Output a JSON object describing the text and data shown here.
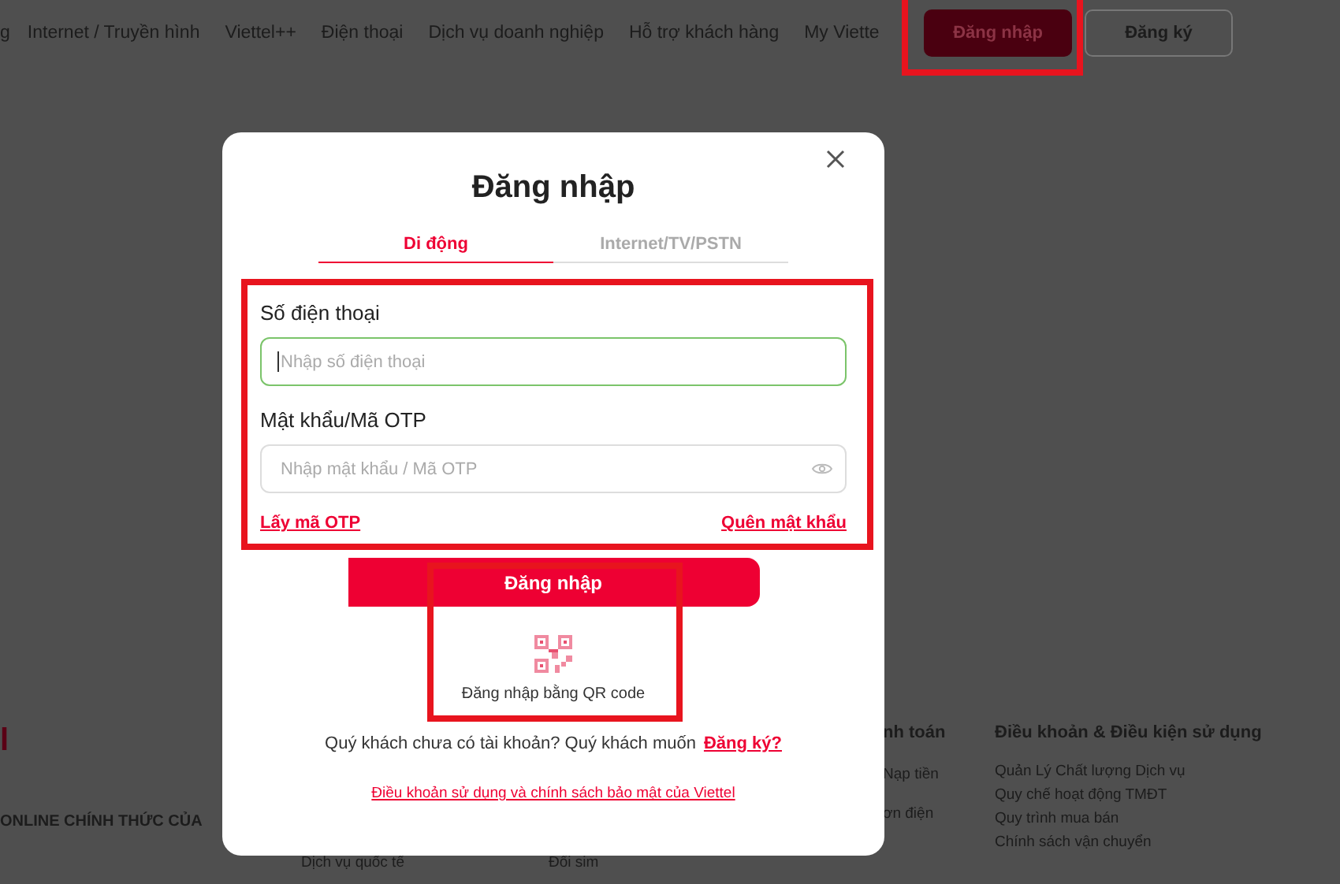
{
  "nav": {
    "items": [
      "g",
      "Internet / Truyền hình",
      "Viettel++",
      "Điện thoại",
      "Dịch vụ doanh nghiệp",
      "Hỗ trợ khách hàng",
      "My Viette"
    ],
    "login_button": "Đăng nhập",
    "register_button": "Đăng ký"
  },
  "footer": {
    "brand": "l",
    "tagline": "ONLINE CHÍNH THỨC CỦA",
    "columns": [
      {
        "links": [
          "Dịch vụ quốc tế"
        ]
      },
      {
        "links": [
          "Đổi sim"
        ]
      },
      {
        "heading": "nh toán",
        "links": [
          "Nạp tiền",
          "ơn điện"
        ]
      },
      {
        "heading": "Điều khoản & Điều kiện sử dụng",
        "links": [
          "Quản Lý Chất lượng Dịch vụ",
          "Quy chế hoạt động TMĐT",
          "Quy trình mua bán",
          "Chính sách vận chuyển"
        ]
      }
    ]
  },
  "dialog": {
    "title": "Đăng nhập",
    "tabs": [
      {
        "label": "Di động",
        "selected": true
      },
      {
        "label": "Internet/TV/PSTN",
        "selected": false
      }
    ],
    "fields": [
      {
        "label": "Số điện thoại",
        "placeholder": "Nhập số điện thoại",
        "kind": "text",
        "focused": true
      },
      {
        "label": "Mật khẩu/Mã OTP",
        "placeholder": "Nhập mật khẩu / Mã OTP",
        "kind": "password",
        "focused": false
      }
    ],
    "links": [
      "Lấy mã OTP",
      "Quên mật khẩu"
    ],
    "submit": "Đăng nhập",
    "qr_label": "Đăng nhập bằng QR code",
    "signup_prompt": "Quý khách chưa có tài khoản? Quý khách muốn",
    "signup_link": "Đăng ký?",
    "terms_link": "Điều khoản sử dụng và chính sách bảo mật của Viettel"
  }
}
